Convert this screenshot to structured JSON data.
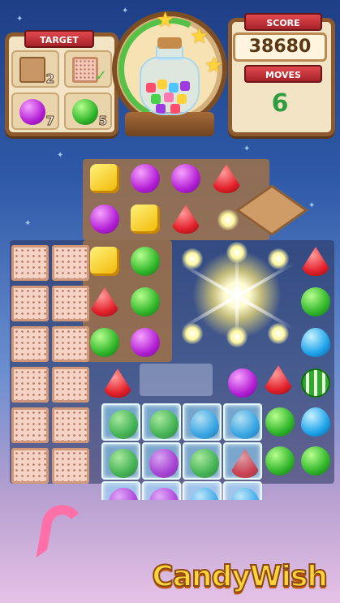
{
  "hud": {
    "target_label": "TARGET",
    "score_label": "SCORE",
    "score_value": "38680",
    "moves_label": "MOVES",
    "moves_value": "6",
    "targets": [
      {
        "icon": "crate-icon",
        "count": "2"
      },
      {
        "icon": "cracker-icon",
        "count": "✓"
      },
      {
        "icon": "purple-candy-icon",
        "count": "7"
      },
      {
        "icon": "green-candy-icon",
        "count": "5"
      }
    ],
    "progress_stars": 3
  },
  "logo": {
    "title": "CandyWish"
  },
  "colors": {
    "wood": "#8d5a2d",
    "ribbon_red": "#c8343a",
    "moves_green": "#2e9c3f",
    "sky_top": "#1d3f86"
  }
}
